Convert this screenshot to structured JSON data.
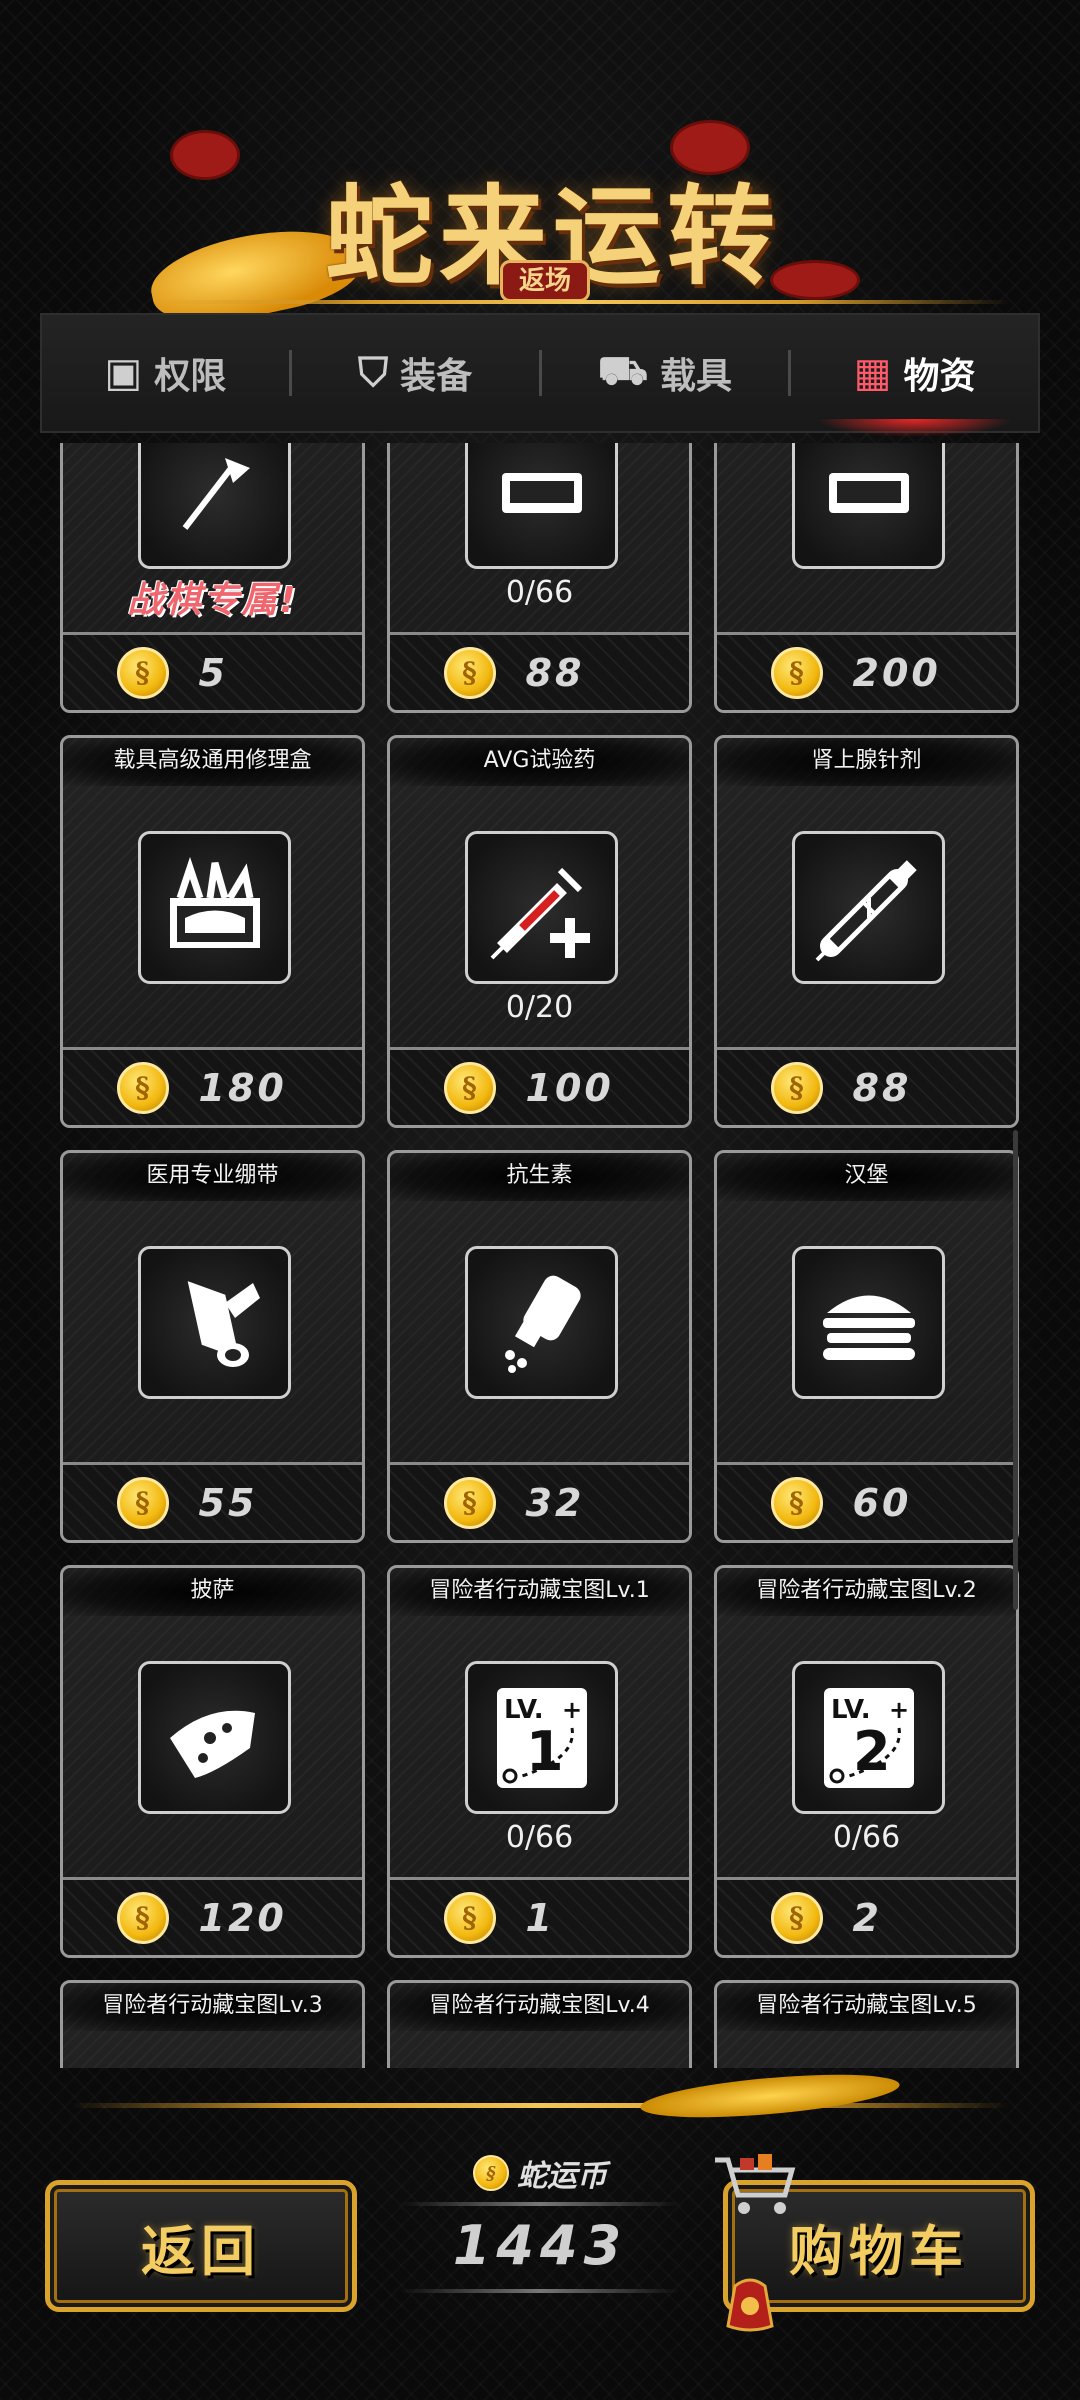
{
  "banner": {
    "title": "蛇来运转",
    "subtitle": "返场"
  },
  "tabs": [
    {
      "label": "权限",
      "icon": "boxes-icon",
      "active": false
    },
    {
      "label": "装备",
      "icon": "shield-knife-icon",
      "active": false
    },
    {
      "label": "载具",
      "icon": "car-icon",
      "active": false
    },
    {
      "label": "物资",
      "icon": "supply-kit-icon",
      "active": true
    }
  ],
  "items": [
    {
      "name": "",
      "icon": "flag-icon",
      "stock": "",
      "special": "战棋专属!",
      "price": "5"
    },
    {
      "name": "",
      "icon": "item-icon",
      "stock": "0/66",
      "special": "",
      "price": "88"
    },
    {
      "name": "",
      "icon": "item-icon",
      "stock": "",
      "special": "",
      "price": "200"
    },
    {
      "name": "载具高级通用修理盒",
      "icon": "toolbox-icon",
      "stock": "",
      "special": "",
      "price": "180"
    },
    {
      "name": "AVG试验药",
      "icon": "syringe-plus-icon",
      "stock": "0/20",
      "special": "",
      "price": "100"
    },
    {
      "name": "肾上腺针剂",
      "icon": "injector-icon",
      "stock": "",
      "special": "",
      "price": "88"
    },
    {
      "name": "医用专业绷带",
      "icon": "bandage-icon",
      "stock": "",
      "special": "",
      "price": "55"
    },
    {
      "name": "抗生素",
      "icon": "pill-bottle-icon",
      "stock": "",
      "special": "",
      "price": "32"
    },
    {
      "name": "汉堡",
      "icon": "burger-icon",
      "stock": "",
      "special": "",
      "price": "60"
    },
    {
      "name": "披萨",
      "icon": "pizza-icon",
      "stock": "",
      "special": "",
      "price": "120"
    },
    {
      "name": "冒险者行动藏宝图Lv.1",
      "icon": "map-lv1-icon",
      "stock": "0/66",
      "special": "",
      "price": "1"
    },
    {
      "name": "冒险者行动藏宝图Lv.2",
      "icon": "map-lv2-icon",
      "stock": "0/66",
      "special": "",
      "price": "2"
    },
    {
      "name": "冒险者行动藏宝图Lv.3",
      "icon": "map-lv3-icon",
      "stock": "",
      "special": "",
      "price": ""
    },
    {
      "name": "冒险者行动藏宝图Lv.4",
      "icon": "map-lv4-icon",
      "stock": "",
      "special": "",
      "price": ""
    },
    {
      "name": "冒险者行动藏宝图Lv.5",
      "icon": "map-lv5-icon",
      "stock": "",
      "special": "",
      "price": ""
    }
  ],
  "footer": {
    "back_label": "返回",
    "currency_label": "蛇运币",
    "currency_amount": "1443",
    "cart_label": "购物车"
  }
}
